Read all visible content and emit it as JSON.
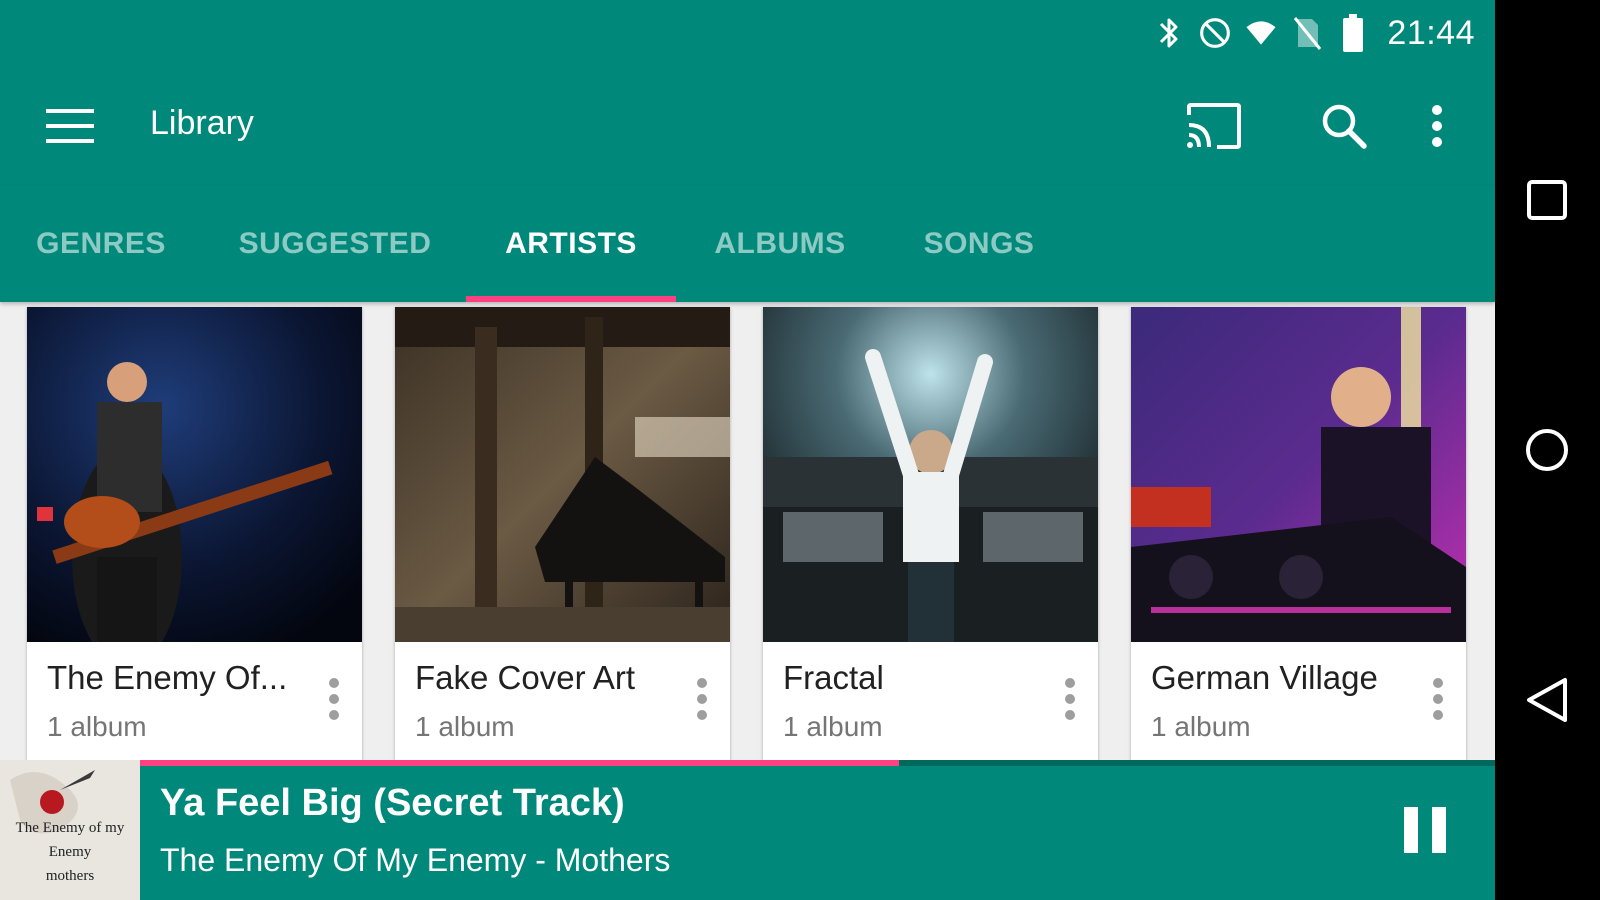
{
  "status_bar": {
    "time": "21:44",
    "icons": [
      "bluetooth-icon",
      "do-not-disturb-icon",
      "wifi-icon",
      "no-sim-icon",
      "battery-icon"
    ]
  },
  "app_bar": {
    "title": "Library",
    "actions": [
      "cast-icon",
      "search-icon",
      "more-vert-icon"
    ]
  },
  "tabs": [
    {
      "label": "GENRES",
      "active": false
    },
    {
      "label": "SUGGESTED",
      "active": false
    },
    {
      "label": "ARTISTS",
      "active": true
    },
    {
      "label": "ALBUMS",
      "active": false
    },
    {
      "label": "SONGS",
      "active": false
    }
  ],
  "artists": [
    {
      "name": "The Enemy Of...",
      "count": "1 album"
    },
    {
      "name": "Fake Cover Art",
      "count": "1 album"
    },
    {
      "name": "Fractal",
      "count": "1 album"
    },
    {
      "name": "German Village",
      "count": "1 album"
    }
  ],
  "now_playing": {
    "title": "Ya Feel Big (Secret Track)",
    "subtitle": "The Enemy Of My Enemy - Mothers",
    "progress": 0.56,
    "album_art_text": [
      "The Enemy of my",
      "Enemy",
      "mothers"
    ]
  },
  "colors": {
    "primary": "#00897b",
    "accent": "#ff4081"
  },
  "nav_bar": [
    "recents-icon",
    "home-icon",
    "back-icon"
  ]
}
